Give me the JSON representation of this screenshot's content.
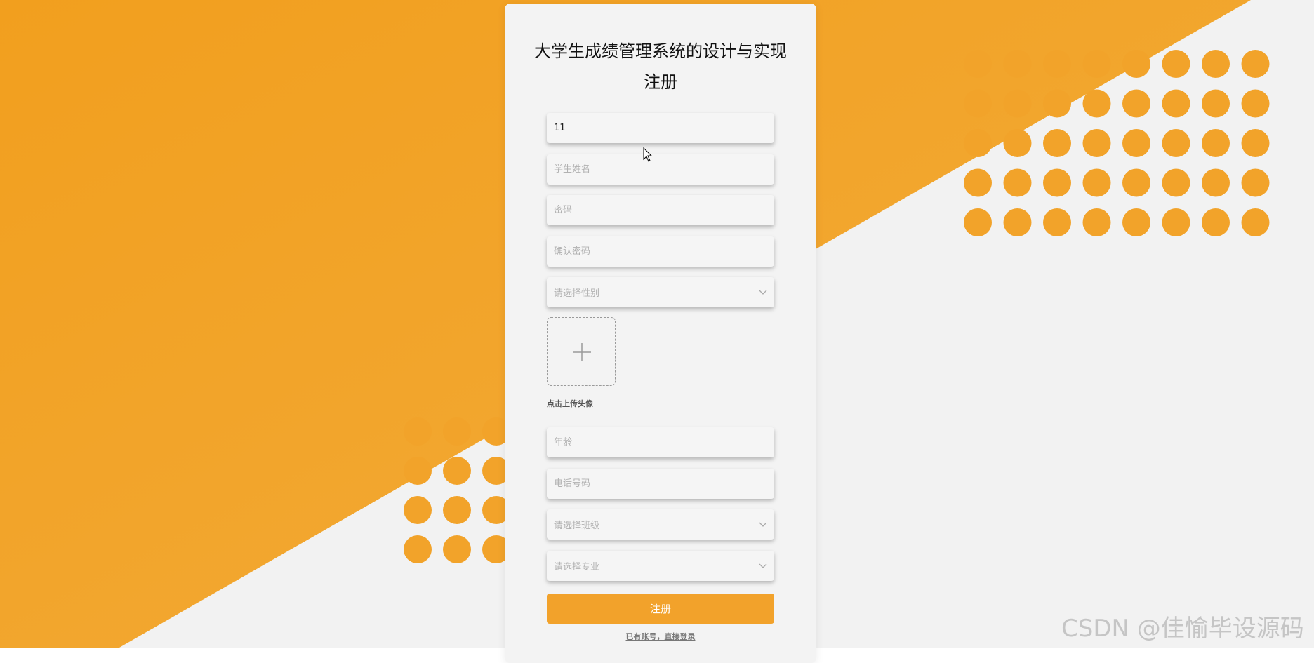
{
  "form": {
    "title": "大学生成绩管理系统的设计与实现",
    "subtitle": "注册",
    "fields": {
      "student_id": {
        "value": "11",
        "placeholder": ""
      },
      "student_name": {
        "placeholder": "学生姓名"
      },
      "password": {
        "placeholder": "密码"
      },
      "confirm_password": {
        "placeholder": "确认密码"
      },
      "gender": {
        "placeholder": "请选择性别"
      },
      "age": {
        "placeholder": "年龄"
      },
      "phone": {
        "placeholder": "电话号码"
      },
      "class": {
        "placeholder": "请选择班级"
      },
      "major": {
        "placeholder": "请选择专业"
      }
    },
    "avatar_upload_hint": "点击上传头像",
    "submit_label": "注册",
    "login_link": "已有账号，直接登录"
  },
  "watermark": "CSDN @佳愉毕设源码",
  "colors": {
    "accent": "#f2a22b",
    "background_light": "#f2f2f2",
    "dots": "#f2a22b"
  },
  "icons": {
    "upload": "plus-icon",
    "dropdown": "chevron-down-icon",
    "cursor": "mouse-pointer-icon"
  }
}
